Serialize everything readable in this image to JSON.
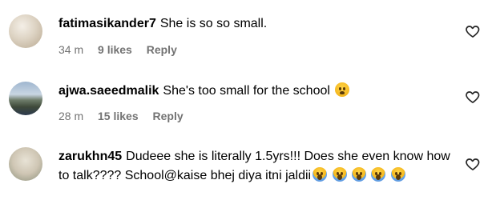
{
  "comments": [
    {
      "username": "fatimasikander7",
      "text": "She is so so small.",
      "time": "34 m",
      "likes": "9 likes",
      "reply": "Reply",
      "emojis": []
    },
    {
      "username": "ajwa.saeedmalik",
      "text": "She's too small for the school",
      "time": "28 m",
      "likes": "15 likes",
      "reply": "Reply",
      "emojis": [
        "anxious-face"
      ]
    },
    {
      "username": "zarukhn45",
      "text": "Dudeee she is literally 1.5yrs!!! Does she even know how to talk???? School@kaise bhej diya itni jaldii",
      "time": "",
      "likes": "",
      "reply": "",
      "emojis": [
        "face-screaming-in-fear",
        "face-screaming-in-fear",
        "face-screaming-in-fear",
        "face-screaming-in-fear",
        "face-screaming-in-fear"
      ]
    }
  ],
  "icons": {
    "like": "heart-outline-icon"
  },
  "colors": {
    "meta_text": "#737373",
    "background": "#ffffff"
  }
}
